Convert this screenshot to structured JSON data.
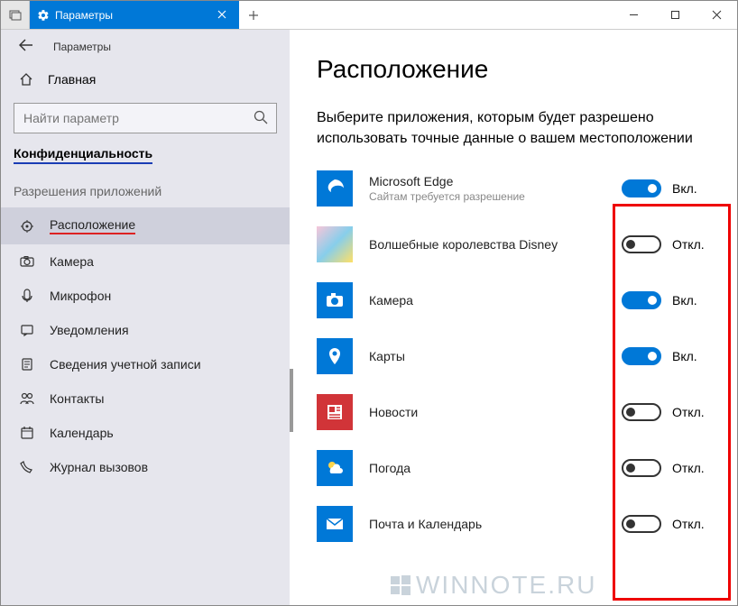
{
  "titlebar": {
    "tab_title": "Параметры"
  },
  "crumb": {
    "label": "Параметры"
  },
  "sidebar": {
    "home": "Главная",
    "search_placeholder": "Найти параметр",
    "category": "Конфиденциальность",
    "subhead": "Разрешения приложений",
    "items": [
      {
        "label": "Расположение",
        "selected": true
      },
      {
        "label": "Камера"
      },
      {
        "label": "Микрофон"
      },
      {
        "label": "Уведомления"
      },
      {
        "label": "Сведения учетной записи"
      },
      {
        "label": "Контакты"
      },
      {
        "label": "Календарь"
      },
      {
        "label": "Журнал вызовов"
      }
    ]
  },
  "main": {
    "heading": "Расположение",
    "desc": "Выберите приложения, которым будет разрешено использовать точные данные о вашем местоположении",
    "state_on": "Вкл.",
    "state_off": "Откл.",
    "apps": [
      {
        "name": "Microsoft Edge",
        "sub": "Сайтам требуется разрешение",
        "on": true,
        "icon": "edge"
      },
      {
        "name": "Волшебные королевства Disney",
        "on": false,
        "icon": "disney"
      },
      {
        "name": "Камера",
        "on": true,
        "icon": "camera"
      },
      {
        "name": "Карты",
        "on": true,
        "icon": "maps"
      },
      {
        "name": "Новости",
        "on": false,
        "icon": "news"
      },
      {
        "name": "Погода",
        "on": false,
        "icon": "weather"
      },
      {
        "name": "Почта и Календарь",
        "on": false,
        "icon": "mail"
      }
    ]
  },
  "watermark": "WINNOTE.RU"
}
